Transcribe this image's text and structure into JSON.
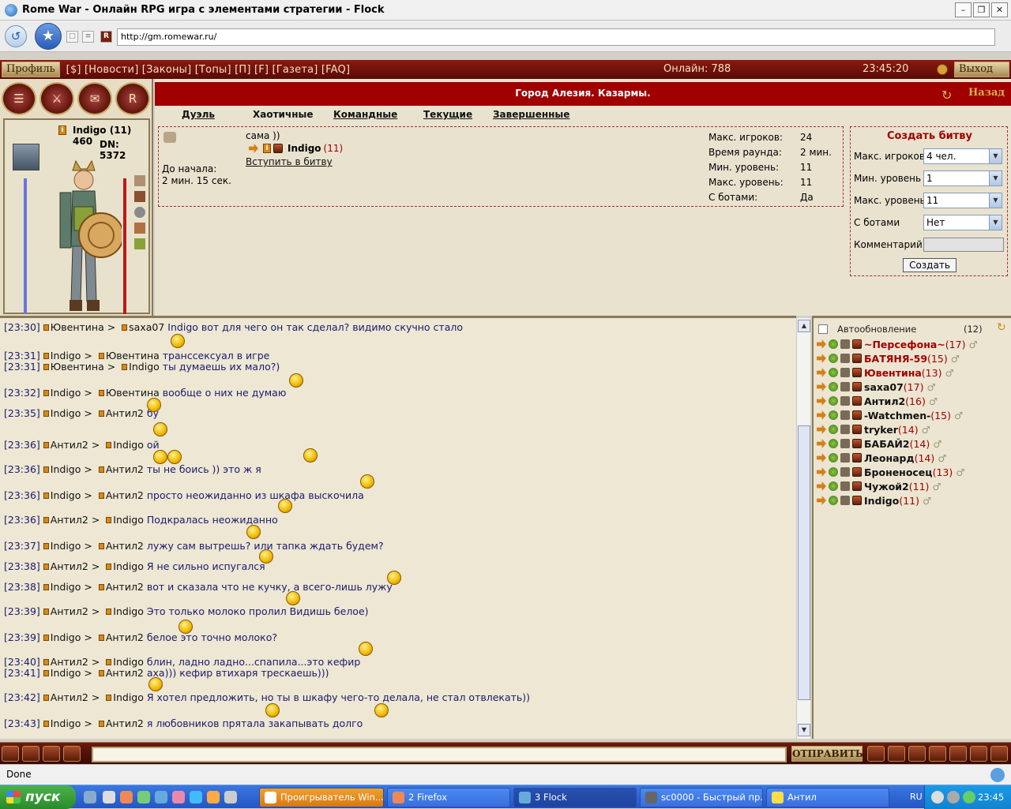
{
  "window": {
    "title": "Rome War - Онлайн RPG игра с элементами стратегии - Flock",
    "url": "http://gm.romewar.ru/"
  },
  "topmenu": {
    "profile_label": "Профиль",
    "links": "[$] [Новости] [Законы] [Топы] [П] [F] [Газета] [FAQ]",
    "online": "Онлайн: 788",
    "time": "23:45:20",
    "exit_label": "Выход"
  },
  "character": {
    "name": "Indigo (11) 460",
    "dn": "DN: 5372"
  },
  "location": {
    "title": "Город Алезия. Казармы.",
    "back_label": "Назад"
  },
  "tabs": [
    {
      "label": "Дуэль"
    },
    {
      "label": "Хаотичные"
    },
    {
      "label": "Командные"
    },
    {
      "label": "Текущие"
    },
    {
      "label": "Завершенные"
    }
  ],
  "battle": {
    "start_label": "До начала:",
    "start_value": "2 мин. 15 сек.",
    "comment": "сама ))",
    "player_name": "Indigo",
    "player_level": "(11)",
    "join_label": "Вступить в битву",
    "props": [
      {
        "key": "Макс. игроков:",
        "value": "24"
      },
      {
        "key": "Время раунда:",
        "value": "2 мин."
      },
      {
        "key": "Мин. уровень:",
        "value": "11"
      },
      {
        "key": "Макс. уровень:",
        "value": "11"
      },
      {
        "key": "С ботами:",
        "value": "Да"
      }
    ]
  },
  "create": {
    "title": "Создать битву",
    "max_players_label": "Макс. игроков",
    "max_players_value": "4 чел.",
    "min_level_label": "Мин. уровень",
    "min_level_value": "1",
    "max_level_label": "Макс. уровень",
    "max_level_value": "11",
    "bots_label": "С ботами",
    "bots_value": "Нет",
    "comment_label": "Комментарий:",
    "submit_label": "Создать"
  },
  "chat": {
    "messages": [
      {
        "time": "[23:30]",
        "from": "Ювентина",
        "to": "saxa07",
        "text": "Indigo вот для чего он так сделал? видимо скучно стало"
      },
      {
        "time": "[23:31]",
        "from": "Indigo",
        "to": "Ювентина",
        "text": "транссексуал в игре"
      },
      {
        "time": "[23:31]",
        "from": "Ювентина",
        "to": "Indigo",
        "text": "ты думаешь их мало?)"
      },
      {
        "time": "[23:32]",
        "from": "Indigo",
        "to": "Ювентина",
        "text": "вообще о них не думаю"
      },
      {
        "time": "[23:35]",
        "from": "Indigo",
        "to": "Антил2",
        "text": "бу"
      },
      {
        "time": "[23:36]",
        "from": "Антил2",
        "to": "Indigo",
        "text": "ой"
      },
      {
        "time": "[23:36]",
        "from": "Indigo",
        "to": "Антил2",
        "text": "ты не боись )) это ж я"
      },
      {
        "time": "[23:36]",
        "from": "Indigo",
        "to": "Антил2",
        "text": "просто неожиданно из шкафа выскочила"
      },
      {
        "time": "[23:36]",
        "from": "Антил2",
        "to": "Indigo",
        "text": "Подкралась неожиданно"
      },
      {
        "time": "[23:37]",
        "from": "Indigo",
        "to": "Антил2",
        "text": "лужу сам вытрешь?     или тапка ждать будем?"
      },
      {
        "time": "[23:38]",
        "from": "Антил2",
        "to": "Indigo",
        "text": "Я не сильно испугался"
      },
      {
        "time": "[23:38]",
        "from": "Indigo",
        "to": "Антил2",
        "text": "вот и сказала что не кучку, а всего-лишь лужу"
      },
      {
        "time": "[23:39]",
        "from": "Антил2",
        "to": "Indigo",
        "text": "Это только молоко пролил     Видишь белое)"
      },
      {
        "time": "[23:39]",
        "from": "Indigo",
        "to": "Антил2",
        "text": "белое       это точно молоко?"
      },
      {
        "time": "[23:40]",
        "from": "Антил2",
        "to": "Indigo",
        "text": "блин, ладно ладно...спапила...это кефир"
      },
      {
        "time": "[23:41]",
        "from": "Indigo",
        "to": "Антил2",
        "text": "аха))) кефир втихаря трескаешь)))"
      },
      {
        "time": "[23:42]",
        "from": "Антил2",
        "to": "Indigo",
        "text": "       Я хотел предложить, но ты в шкафу чего-то делала, не стал отвлекать))"
      },
      {
        "time": "[23:43]",
        "from": "Indigo",
        "to": "Антил2",
        "text": "я любовников прятала       закапывать долго"
      }
    ],
    "send_label": "ОТПРАВИТЬ"
  },
  "userlist": {
    "auto_label": "Автообновление",
    "count": "(12)",
    "users": [
      {
        "name": "~Персефона~",
        "level": "(17)",
        "highlight": true
      },
      {
        "name": "БАТЯНЯ-59",
        "level": "(15)",
        "highlight": true
      },
      {
        "name": "Ювентина",
        "level": "(13)",
        "highlight": true
      },
      {
        "name": "saxa07",
        "level": "(17)",
        "highlight": false
      },
      {
        "name": "Антил2",
        "level": "(16)",
        "highlight": false
      },
      {
        "name": "-Watchmen-",
        "level": "(15)",
        "highlight": false
      },
      {
        "name": "tryker",
        "level": "(14)",
        "highlight": false
      },
      {
        "name": "БАБАЙ2",
        "level": "(14)",
        "highlight": false
      },
      {
        "name": "Леонард",
        "level": "(14)",
        "highlight": false
      },
      {
        "name": "Броненосец",
        "level": "(13)",
        "highlight": false
      },
      {
        "name": "Чужой2",
        "level": "(11)",
        "highlight": false
      },
      {
        "name": "Indigo",
        "level": "(11)",
        "highlight": false
      }
    ]
  },
  "statusbar": {
    "text": "Done"
  },
  "taskbar": {
    "start_label": "пуск",
    "tasks": [
      {
        "label": "Проигрыватель Win..."
      },
      {
        "label": "2 Firefox"
      },
      {
        "label": "3 Flock"
      },
      {
        "label": "sc0000 - Быстрый пр..."
      },
      {
        "label": "Антил"
      }
    ],
    "lang": "RU",
    "clock": "23:45"
  },
  "colors": {
    "accent_red": "#a00000",
    "menu_bar": "#6a1a10",
    "parchment": "#e9e2cf",
    "taskbar": "#2456c4"
  }
}
